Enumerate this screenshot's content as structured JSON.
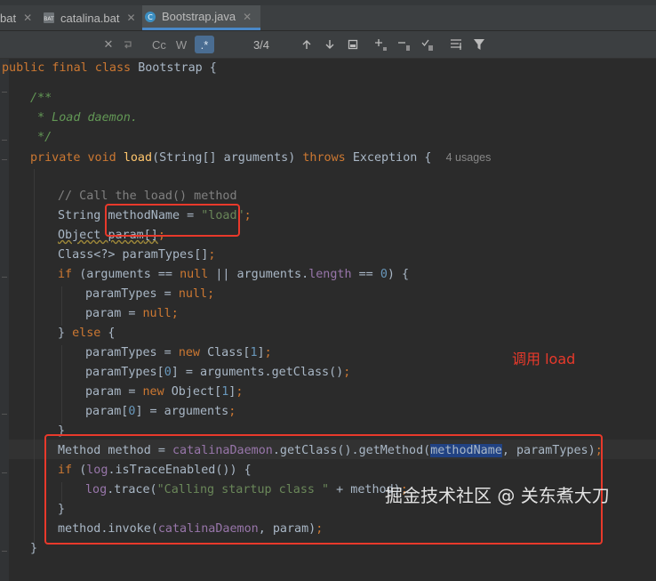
{
  "tabs": [
    {
      "label": "bat",
      "icon": "bat-file-icon",
      "active": false
    },
    {
      "label": "catalina.bat",
      "icon": "bat-file-icon",
      "active": false
    },
    {
      "label": "Bootstrap.java",
      "icon": "java-class-icon",
      "active": true
    }
  ],
  "find_bar": {
    "match_case": "Cc",
    "words": "W",
    "regex": ".*",
    "match_count": "3/4"
  },
  "code": {
    "l1_kw": "public final class ",
    "l1_name": "Bootstrap {",
    "l2_doc": "/**",
    "l3_doc": " * Load daemon.",
    "l4_doc": " */",
    "l5_kw1": "private void ",
    "l5_fn": "load",
    "l5_mid": "(String[] arguments) ",
    "l5_kw2": "throws ",
    "l5_end": "Exception {",
    "l5_hint": "4 usages",
    "l6_comment": "// Call the load() method",
    "l7_a": "String ",
    "l7_b": "methodName = ",
    "l7_str": "\"load\"",
    "l7_semi": ";",
    "l8_a": "Object ",
    "l8_b": "param",
    "l8_c": "[]",
    "l8_semi": ";",
    "l9_a": "Class<?> paramTypes",
    "l9_b": "[]",
    "l9_semi": ";",
    "l10_kw": "if ",
    "l10_a": "(arguments == ",
    "l10_null": "null ",
    "l10_b": "|| arguments.",
    "l10_fld": "length",
    "l10_c": " == ",
    "l10_num": "0",
    "l10_d": ") {",
    "l11_a": "paramTypes = ",
    "l11_null": "null",
    "l11_semi": ";",
    "l12_a": "param = ",
    "l12_null": "null",
    "l12_semi": ";",
    "l13_a": "} ",
    "l13_kw": "else",
    "l13_b": " {",
    "l14_a": "paramTypes = ",
    "l14_kw": "new ",
    "l14_b": "Class[",
    "l14_num": "1",
    "l14_c": "]",
    "l14_semi": ";",
    "l15_a": "paramTypes[",
    "l15_num": "0",
    "l15_b": "] = arguments.getClass()",
    "l15_semi": ";",
    "l16_a": "param = ",
    "l16_kw": "new ",
    "l16_b": "Object[",
    "l16_num": "1",
    "l16_c": "]",
    "l16_semi": ";",
    "l17_a": "param[",
    "l17_num": "0",
    "l17_b": "] = arguments",
    "l17_semi": ";",
    "l18": "}",
    "l19_a": "Method method = ",
    "l19_fld": "catalinaDaemon",
    "l19_b": ".getClass().getMethod(",
    "l19_hl": "methodName",
    "l19_c": ", paramTypes)",
    "l19_semi": ";",
    "l20_kw": "if ",
    "l20_a": "(",
    "l20_fld": "log",
    "l20_b": ".isTraceEnabled()) {",
    "l21_fld": "log",
    "l21_a": ".trace(",
    "l21_str": "\"Calling startup class \"",
    "l21_b": " + method)",
    "l21_semi": ";",
    "l22": "}",
    "l23_a": "method.invoke(",
    "l23_fld": "catalinaDaemon",
    "l23_b": ", param)",
    "l23_semi": ";",
    "l24": "}"
  },
  "annotation": "调用 load",
  "watermark": "掘金技术社区 @ 关东煮大刀",
  "colors": {
    "annotation_red": "#e8392b",
    "keyword": "#cc7832",
    "string": "#6a8759",
    "background": "#2b2b2b"
  }
}
